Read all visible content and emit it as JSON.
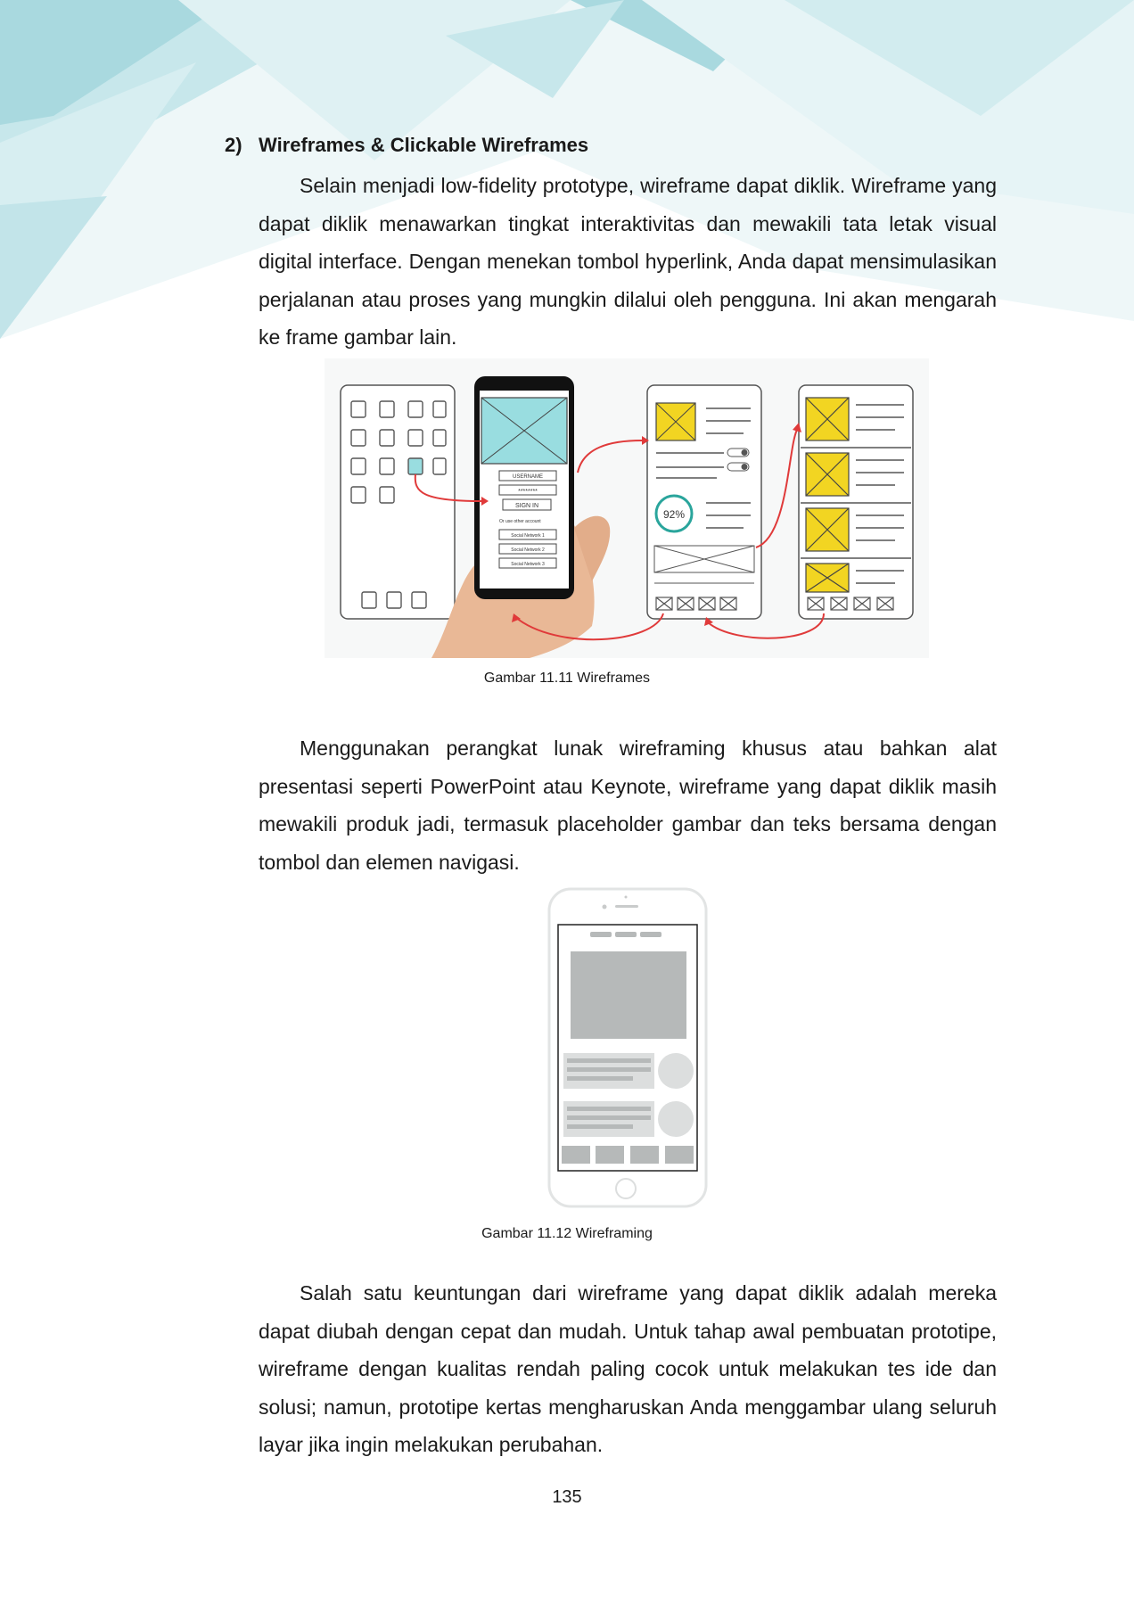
{
  "header_decoration": {
    "colors": [
      "#a9d9df",
      "#c7e7eb",
      "#dff1f3",
      "#8ccbd4"
    ]
  },
  "section": {
    "number": "2)",
    "title": "Wireframes & Clickable Wireframes"
  },
  "paragraphs": [
    "Selain menjadi low-fidelity prototype, wireframe dapat diklik. Wireframe yang dapat diklik menawarkan tingkat interaktivitas dan mewakili tata letak visual digital interface. Dengan menekan tombol hyperlink, Anda dapat mensimulasikan perjalanan atau proses yang mungkin dilalui oleh pengguna. Ini akan mengarah ke frame gambar lain.",
    "Menggunakan perangkat lunak wireframing khusus atau bahkan alat presentasi seperti PowerPoint atau Keynote, wireframe yang dapat diklik masih mewakili produk jadi, termasuk placeholder gambar dan teks bersama dengan tombol dan elemen navigasi.",
    "Salah satu keuntungan dari wireframe yang dapat diklik adalah mereka dapat diubah dengan cepat dan mudah. Untuk tahap awal pembuatan prototipe, wireframe dengan kualitas rendah paling cocok untuk melakukan tes ide dan solusi; namun, prototipe kertas mengharuskan Anda menggambar ulang seluruh layar jika ingin melakukan perubahan."
  ],
  "figures": [
    {
      "caption": "Gambar 11.11 Wireframes",
      "sketch_text": {
        "username": "USERNAME",
        "password": "********",
        "sign_in": "SIGN IN",
        "alt_account": "Or use other account",
        "social_1": "Social Network 1",
        "social_2": "Social Network 2",
        "social_3": "Social Network 3",
        "progress": "92%"
      },
      "colors": {
        "cyan": "#99dde0",
        "yellow": "#f2d522",
        "arrow": "#e03a3a",
        "skin": "#e9b896"
      }
    },
    {
      "caption": "Gambar 11.12 Wireframing",
      "colors": {
        "placeholder": "#b6b9b9",
        "light": "#dcdede"
      }
    }
  ],
  "page_number": "135"
}
